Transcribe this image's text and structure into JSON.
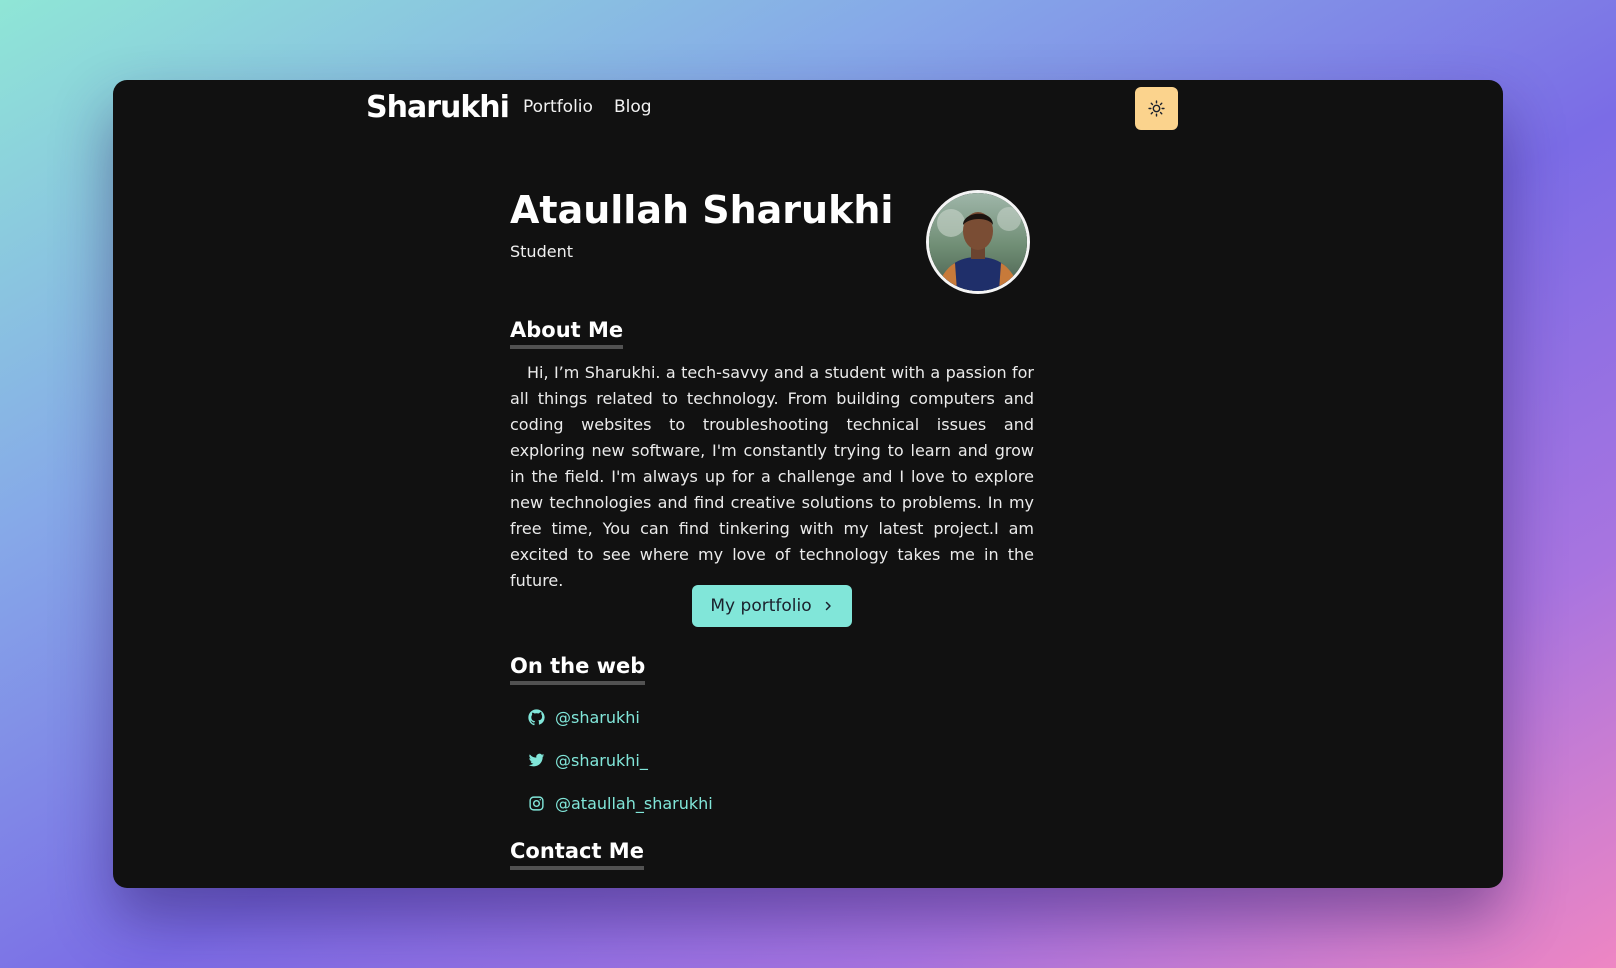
{
  "nav": {
    "brand": "Sharukhi",
    "links": [
      "Portfolio",
      "Blog"
    ],
    "theme_toggle_icon": "sun-icon",
    "theme_toggle_color": "#fbd38d"
  },
  "profile": {
    "name": "Ataullah Sharukhi",
    "role": "Student",
    "avatar": "profile-photo"
  },
  "about": {
    "title": "About Me",
    "text": "Hi, I’m Sharukhi. a tech-savvy and a student with a passion for all things related to technology. From building computers and coding websites to troubleshooting technical issues and exploring new software, I'm constantly trying to learn and grow in the field. I'm always up for a challenge and I love to explore new technologies and find creative solutions to problems. In my free time, You can find tinkering with my latest project.I am excited to see where my love of technology takes me in the future.",
    "cta_label": "My portfolio",
    "cta_icon": "chevron-right-icon",
    "accent": "#81e6d9"
  },
  "web": {
    "title": "On the web",
    "links": [
      {
        "icon": "github-icon",
        "handle": "@sharukhi"
      },
      {
        "icon": "twitter-icon",
        "handle": "@sharukhi_"
      },
      {
        "icon": "instagram-icon",
        "handle": "@ataullah_sharukhi"
      }
    ]
  },
  "contact": {
    "title": "Contact Me"
  }
}
